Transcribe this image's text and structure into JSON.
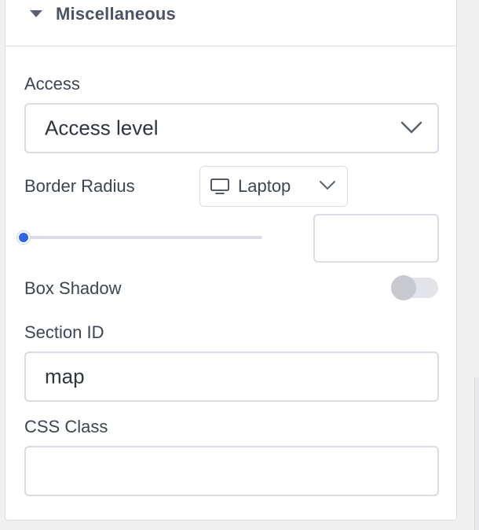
{
  "panel": {
    "title": "Miscellaneous"
  },
  "access": {
    "label": "Access",
    "value": "Access level"
  },
  "border_radius": {
    "label": "Border Radius",
    "device": "Laptop",
    "slider_value_fraction": 0,
    "input_value": ""
  },
  "box_shadow": {
    "label": "Box Shadow",
    "enabled": false
  },
  "section_id": {
    "label": "Section ID",
    "value": "map"
  },
  "css_class": {
    "label": "CSS Class",
    "value": ""
  },
  "colors": {
    "accent": "#2d65e6",
    "border": "#dadbe6",
    "text": "#3c4456"
  },
  "icons": {
    "collapse": "caret-down-icon",
    "dropdown": "chevron-down-icon",
    "device": "laptop-icon"
  }
}
